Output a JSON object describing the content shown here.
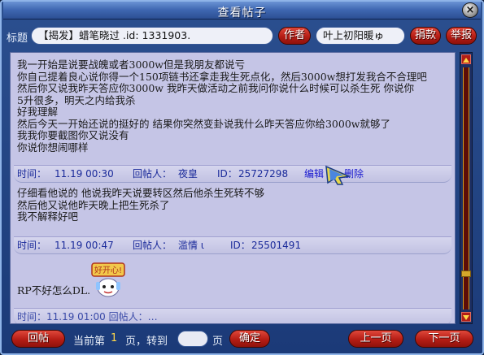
{
  "window": {
    "title": "查看帖子",
    "close_label": "×"
  },
  "header": {
    "title_label": "标题",
    "title_value": "【揭发】蜡笔晓过 .id: 1331903.",
    "author_button": "作者",
    "author_value": "叶上初阳暖ゅ",
    "donate_button": "捐款",
    "report_button": "举报"
  },
  "posts": [
    {
      "body": "我一开始是说要战魄或者3000w但是我朋友都说亏\n你自己提着良心说你得一个150项链书还拿走我生死点化，然后3000w想打发我合不合理吧\n然后你又说我昨天答应你3000w 我昨天做活动之前我问你说什么时候可以杀生死 你说你\n5升很多，明天之内给我杀\n好我理解\n然后今天一开始还说的挺好的 结果你突然变卦说我什么昨天答应你给3000w就够了\n我我你要截图你又说没有\n你说你想闹哪样",
      "time_label": "时间：",
      "time": "11.19 00:30",
      "replier_label": "回帖人：",
      "replier": "夜皇",
      "id_label": "ID：",
      "id": "25727298",
      "edit_label": "编辑",
      "delete_label": "删除"
    },
    {
      "body": "仔细看他说的 他说我昨天说要转区然后他杀生死转不够\n然后他又说他昨天晚上把生死杀了\n我不解释好吧",
      "time_label": "时间：",
      "time": "11.19 00:47",
      "replier_label": "回帖人：",
      "replier": "滥情 ι",
      "id_label": "ID：",
      "id": "25501491"
    },
    {
      "body": "RP不好怎么DL.",
      "sticker_text": "好开心!",
      "partial_meta": "时间：11.19 01:00    回帖人：…"
    }
  ],
  "footer": {
    "reply_button": "回帖",
    "current_label": "当前第",
    "current_page": "1",
    "goto_label": "页，转到",
    "page_suffix": "页",
    "confirm_button": "确定",
    "prev_button": "上一页",
    "next_button": "下一页"
  },
  "colors": {
    "accent_red": "#b51d15",
    "content_bg": "#c5c5e6",
    "window_blue": "#1b3a78"
  }
}
